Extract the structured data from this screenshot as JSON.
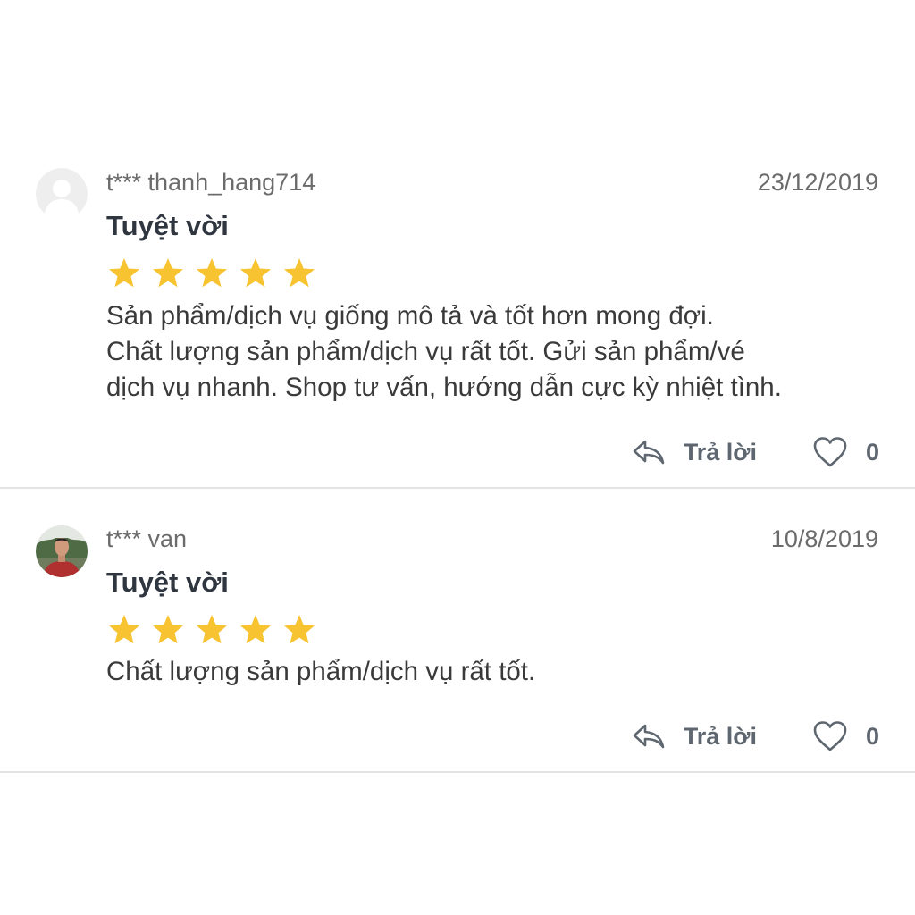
{
  "reviews": [
    {
      "username": "t*** thanh_hang714",
      "date": "23/12/2019",
      "title": "Tuyệt vời",
      "rating": 5,
      "comment_lines": [
        "Sản phẩm/dịch vụ giống mô tả và tốt hơn mong đợi.",
        "Chất lượng sản phẩm/dịch vụ rất tốt. Gửi sản phẩm/vé",
        "dịch vụ nhanh. Shop tư vấn, hướng dẫn cực kỳ nhiệt tình."
      ],
      "reply_label": "Trả lời",
      "like_count": "0",
      "avatar": "default-avatar-icon"
    },
    {
      "username": "t*** van",
      "date": "10/8/2019",
      "title": "Tuyệt vời",
      "rating": 5,
      "comment_lines": [
        "Chất lượng sản phẩm/dịch vụ rất tốt."
      ],
      "reply_label": "Trả lời",
      "like_count": "0",
      "avatar": "user-photo"
    }
  ],
  "colors": {
    "star": "#f7c331",
    "divider": "#e3e3e3",
    "action": "#5e6670"
  }
}
